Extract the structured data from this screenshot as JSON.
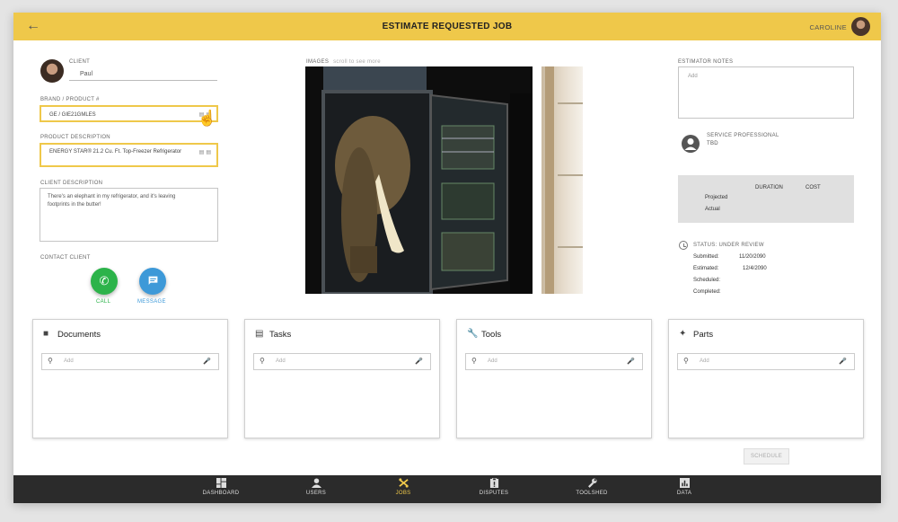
{
  "header": {
    "title": "ESTIMATE REQUESTED JOB",
    "user_name": "CAROLINE"
  },
  "client": {
    "label": "CLIENT",
    "value": "Paul"
  },
  "brand": {
    "label": "BRAND / PRODUCT #",
    "value": "GE / GIE21GMLES"
  },
  "product": {
    "label": "PRODUCT DESCRIPTION",
    "value": "ENERGY STAR® 21.2 Cu. Ft. Top-Freezer Refrigerator"
  },
  "client_description": {
    "label": "CLIENT DESCRIPTION",
    "value": "There's an elephant in my refrigerator, and it's leaving footprints in the butter!"
  },
  "contact": {
    "label": "CONTACT CLIENT",
    "call_label": "CALL",
    "message_label": "MESSAGE"
  },
  "images": {
    "label": "IMAGES",
    "hint": "scroll to see more"
  },
  "estimator_notes": {
    "label": "ESTIMATOR NOTES",
    "placeholder": "Add"
  },
  "service_professional": {
    "label": "SERVICE PROFESSIONAL",
    "value": "TBD"
  },
  "estimate_table": {
    "col_duration": "DURATION",
    "col_cost": "COST",
    "row_projected": "Projected",
    "row_actual": "Actual"
  },
  "status": {
    "label": "STATUS: UNDER REVIEW",
    "rows": [
      {
        "label": "Submitted:",
        "value": "11/20/2090"
      },
      {
        "label": "Estimated:",
        "value": "12/4/2090"
      },
      {
        "label": "Scheduled:",
        "value": ""
      },
      {
        "label": "Completed:",
        "value": ""
      }
    ]
  },
  "panels": [
    {
      "title": "Documents",
      "placeholder": "Add"
    },
    {
      "title": "Tasks",
      "placeholder": "Add"
    },
    {
      "title": "Tools",
      "placeholder": "Add"
    },
    {
      "title": "Parts",
      "placeholder": "Add"
    }
  ],
  "schedule_label": "SCHEDULE",
  "nav": [
    {
      "label": "DASHBOARD",
      "icon": "dashboard-icon"
    },
    {
      "label": "USERS",
      "icon": "user-icon"
    },
    {
      "label": "JOBS",
      "icon": "jobs-icon",
      "active": true
    },
    {
      "label": "DISPUTES",
      "icon": "disputes-icon"
    },
    {
      "label": "TOOLSHED",
      "icon": "wrench-icon"
    },
    {
      "label": "DATA",
      "icon": "chart-icon"
    }
  ],
  "colors": {
    "accent": "#efc84a",
    "call": "#2cb34a",
    "message": "#3d99d8",
    "nav_bg": "#2b2b2b",
    "nav_active": "#efc84a"
  }
}
